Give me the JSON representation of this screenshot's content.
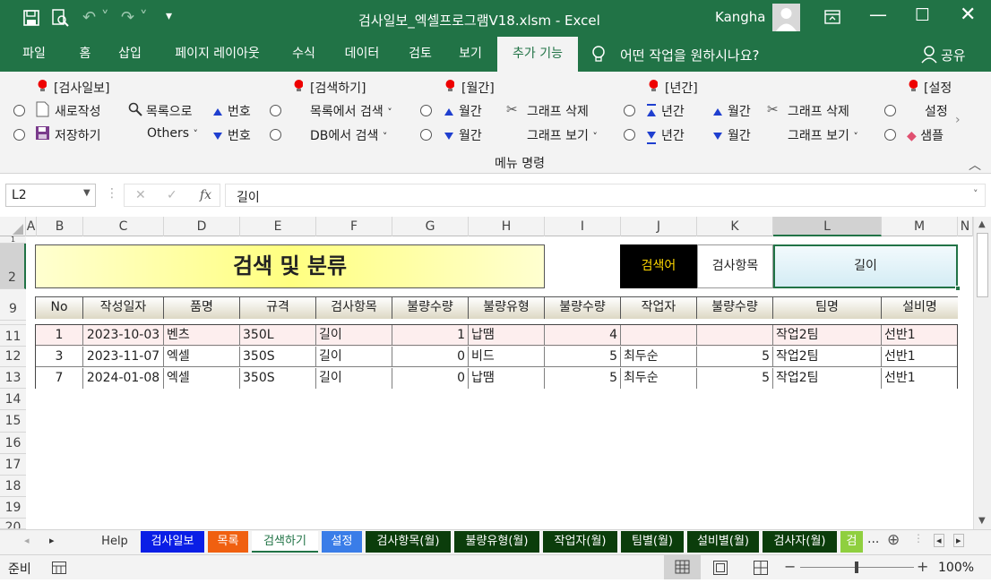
{
  "window": {
    "title": "검사일보_엑셀프로그램V18.xlsm  -  Excel",
    "user": "Kangha"
  },
  "tabs": [
    "파일",
    "홈",
    "삽입",
    "페이지 레이아웃",
    "수식",
    "데이터",
    "검토",
    "보기",
    "추가 기능"
  ],
  "tell_me": "어떤 작업을 원하시나요?",
  "share": "공유",
  "ribbon": {
    "group_label": "메뉴 명령",
    "g1": {
      "title": "[검사일보]",
      "new": "새로작성",
      "save": "저장하기",
      "to_list": "목록으로",
      "others": "Others",
      "num1": "번호",
      "num2": "번호"
    },
    "g2": {
      "title": "[검색하기]",
      "list_search": "목록에서 검색",
      "db_search": "DB에서 검색"
    },
    "g3": {
      "title": "[월간]",
      "m1": "월간",
      "m2": "월간",
      "delete": "그래프 삭제",
      "show": "그래프 보기"
    },
    "g4": {
      "title": "[년간]",
      "y1": "년간",
      "y2": "년간",
      "m1": "월간",
      "m2": "월간",
      "delete": "그래프 삭제",
      "show": "그래프 보기"
    },
    "g5": {
      "title": "[설정",
      "set": "설정",
      "sample": "샘플"
    }
  },
  "formula": {
    "namebox": "L2",
    "value": "길이"
  },
  "columns": [
    "A",
    "B",
    "C",
    "D",
    "E",
    "F",
    "G",
    "H",
    "I",
    "J",
    "K",
    "L",
    "M",
    "N"
  ],
  "rows": [
    "1",
    "2",
    "9",
    "11",
    "12",
    "13",
    "14",
    "15",
    "16",
    "17",
    "18",
    "19",
    "20"
  ],
  "sheet": {
    "title": "검색 및 분류",
    "search_label": "검색어",
    "search_item_label": "검사항목",
    "search_value": "길이",
    "headers": [
      "No",
      "작성일자",
      "품명",
      "규격",
      "검사항목",
      "불량수량",
      "불량유형",
      "불량수량",
      "작업자",
      "불량수량",
      "팀명",
      "설비명"
    ],
    "data": [
      [
        "1",
        "2023-10-03",
        "벤츠",
        "350L",
        "길이",
        "1",
        "납땜",
        "4",
        "",
        "",
        "작업2팀",
        "선반1"
      ],
      [
        "3",
        "2023-11-07",
        "엑셀",
        "350S",
        "길이",
        "0",
        "비드",
        "5",
        "최두순",
        "5",
        "작업2팀",
        "선반1"
      ],
      [
        "7",
        "2024-01-08",
        "엑셀",
        "350S",
        "길이",
        "0",
        "납땜",
        "5",
        "최두순",
        "5",
        "작업2팀",
        "선반1"
      ]
    ]
  },
  "sheet_tabs": [
    {
      "label": "Help",
      "color": "#f3f3f3",
      "text": "#333"
    },
    {
      "label": "검사일보",
      "color": "#0a1ee6",
      "text": "#fff"
    },
    {
      "label": "목록",
      "color": "#f06010",
      "text": "#fff"
    },
    {
      "label": "검색하기",
      "color": "#ffffff",
      "text": "#217346"
    },
    {
      "label": "설정",
      "color": "#3a7de8",
      "text": "#fff"
    },
    {
      "label": "검사항목(월)",
      "color": "#0b3d0b",
      "text": "#fff"
    },
    {
      "label": "불량유형(월)",
      "color": "#0b3d0b",
      "text": "#fff"
    },
    {
      "label": "작업자(월)",
      "color": "#0b3d0b",
      "text": "#fff"
    },
    {
      "label": "팀별(월)",
      "color": "#0b3d0b",
      "text": "#fff"
    },
    {
      "label": "설비별(월)",
      "color": "#0b3d0b",
      "text": "#fff"
    },
    {
      "label": "검사자(월)",
      "color": "#0b3d0b",
      "text": "#fff"
    },
    {
      "label": "검",
      "color": "#8fcf3f",
      "text": "#fff"
    }
  ],
  "status": {
    "ready": "준비",
    "zoom": "100%"
  },
  "colors": {
    "excel_green": "#217346",
    "ribbon_bg": "#f3f3f3"
  }
}
